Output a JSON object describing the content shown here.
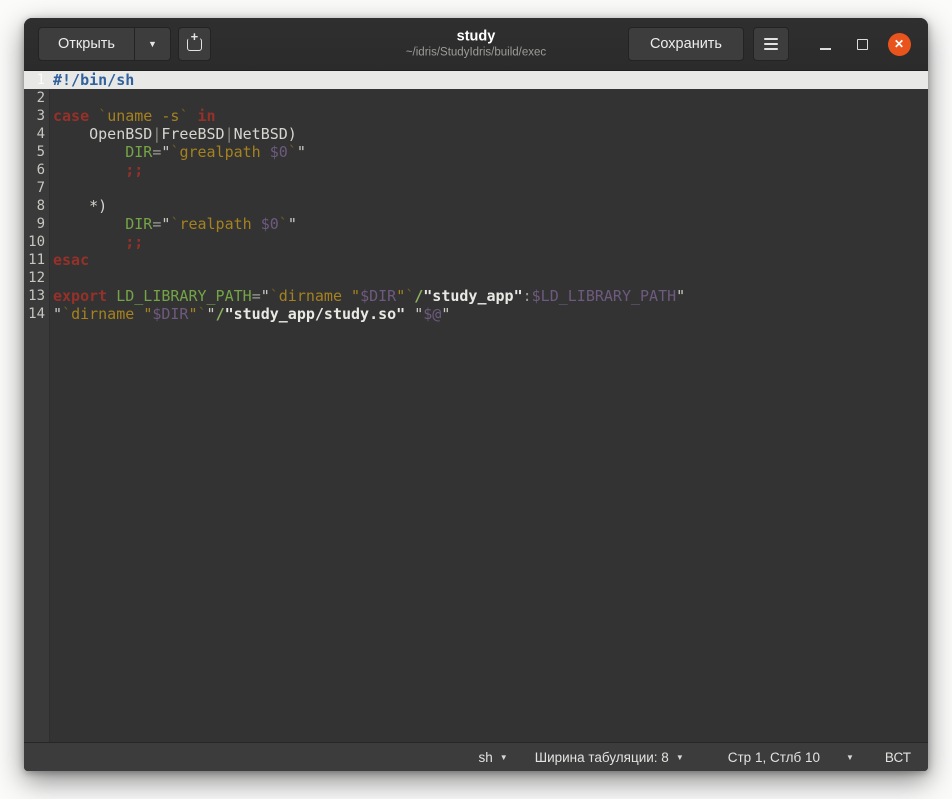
{
  "header": {
    "open_label": "Открыть",
    "save_label": "Сохранить",
    "title": "study",
    "subtitle": "~/idris/StudyIdris/build/exec"
  },
  "icons": {
    "caret_down_solid": "▼",
    "caret_down_small": "▼",
    "close": "✕"
  },
  "colors": {
    "close_button": "#e9541d",
    "titlebar": "#2c2c2c",
    "editor_bg": "#333333",
    "current_line_bg": "#e8e8e6",
    "statusbar_bg": "#3c3c3c"
  },
  "editor": {
    "language": "sh",
    "lines": [
      {
        "n": 1,
        "current": true,
        "tokens": [
          {
            "t": "#!/bin/sh",
            "c": "shebang"
          }
        ]
      },
      {
        "n": 2,
        "tokens": []
      },
      {
        "n": 3,
        "tokens": [
          {
            "t": "case",
            "c": "kw"
          },
          {
            "t": " ",
            "c": "plain"
          },
          {
            "t": "`",
            "c": "cmddim"
          },
          {
            "t": "uname -s",
            "c": "cmd"
          },
          {
            "t": "`",
            "c": "cmddim"
          },
          {
            "t": " ",
            "c": "plain"
          },
          {
            "t": "in",
            "c": "kw"
          }
        ]
      },
      {
        "n": 4,
        "tokens": [
          {
            "t": "    OpenBSD",
            "c": "plain"
          },
          {
            "t": "|",
            "c": "pipe"
          },
          {
            "t": "FreeBSD",
            "c": "plain"
          },
          {
            "t": "|",
            "c": "pipe"
          },
          {
            "t": "NetBSD)",
            "c": "plain"
          }
        ]
      },
      {
        "n": 5,
        "tokens": [
          {
            "t": "        ",
            "c": "plain"
          },
          {
            "t": "DIR",
            "c": "varname"
          },
          {
            "t": "=",
            "c": "op"
          },
          {
            "t": "\"",
            "c": "str"
          },
          {
            "t": "`",
            "c": "cmddim"
          },
          {
            "t": "grealpath ",
            "c": "cmd"
          },
          {
            "t": "$0",
            "c": "var"
          },
          {
            "t": "`",
            "c": "cmddim"
          },
          {
            "t": "\"",
            "c": "str"
          }
        ]
      },
      {
        "n": 6,
        "tokens": [
          {
            "t": "        ",
            "c": "plain"
          },
          {
            "t": ";;",
            "c": "kw"
          }
        ]
      },
      {
        "n": 7,
        "tokens": []
      },
      {
        "n": 8,
        "tokens": [
          {
            "t": "    *)",
            "c": "plain"
          }
        ]
      },
      {
        "n": 9,
        "tokens": [
          {
            "t": "        ",
            "c": "plain"
          },
          {
            "t": "DIR",
            "c": "varname"
          },
          {
            "t": "=",
            "c": "op"
          },
          {
            "t": "\"",
            "c": "str"
          },
          {
            "t": "`",
            "c": "cmddim"
          },
          {
            "t": "realpath ",
            "c": "cmd"
          },
          {
            "t": "$0",
            "c": "var"
          },
          {
            "t": "`",
            "c": "cmddim"
          },
          {
            "t": "\"",
            "c": "str"
          }
        ]
      },
      {
        "n": 10,
        "tokens": [
          {
            "t": "        ",
            "c": "plain"
          },
          {
            "t": ";;",
            "c": "kw"
          }
        ]
      },
      {
        "n": 11,
        "tokens": [
          {
            "t": "esac",
            "c": "kw"
          }
        ]
      },
      {
        "n": 12,
        "tokens": []
      },
      {
        "n": 13,
        "tokens": [
          {
            "t": "export",
            "c": "kw"
          },
          {
            "t": " ",
            "c": "plain"
          },
          {
            "t": "LD_LIBRARY_PATH",
            "c": "varname"
          },
          {
            "t": "=",
            "c": "op"
          },
          {
            "t": "\"",
            "c": "str"
          },
          {
            "t": "`",
            "c": "cmddim"
          },
          {
            "t": "dirname ",
            "c": "cmd"
          },
          {
            "t": "\"",
            "c": "cmd"
          },
          {
            "t": "$DIR",
            "c": "var"
          },
          {
            "t": "\"",
            "c": "cmd"
          },
          {
            "t": "`",
            "c": "cmddim"
          },
          {
            "t": "/",
            "c": "slash"
          },
          {
            "t": "\"study_app\"",
            "c": "strbold"
          },
          {
            "t": ":",
            "c": "op"
          },
          {
            "t": "$LD_LIBRARY_PATH",
            "c": "var"
          },
          {
            "t": "\"",
            "c": "str"
          }
        ]
      },
      {
        "n": 14,
        "tokens": [
          {
            "t": "\"",
            "c": "str"
          },
          {
            "t": "`",
            "c": "cmddim"
          },
          {
            "t": "dirname ",
            "c": "cmd"
          },
          {
            "t": "\"",
            "c": "cmd"
          },
          {
            "t": "$DIR",
            "c": "var"
          },
          {
            "t": "\"",
            "c": "cmd"
          },
          {
            "t": "`",
            "c": "cmddim"
          },
          {
            "t": "\"",
            "c": "str"
          },
          {
            "t": "/",
            "c": "slash"
          },
          {
            "t": "\"study_app/study.so\"",
            "c": "strbold"
          },
          {
            "t": " ",
            "c": "plain"
          },
          {
            "t": "\"",
            "c": "str"
          },
          {
            "t": "$@",
            "c": "var"
          },
          {
            "t": "\"",
            "c": "str"
          }
        ]
      }
    ]
  },
  "statusbar": {
    "language": "sh",
    "tab_width_label": "Ширина табуляции: 8",
    "position": "Стр 1, Стлб 10",
    "mode": "ВСТ"
  }
}
